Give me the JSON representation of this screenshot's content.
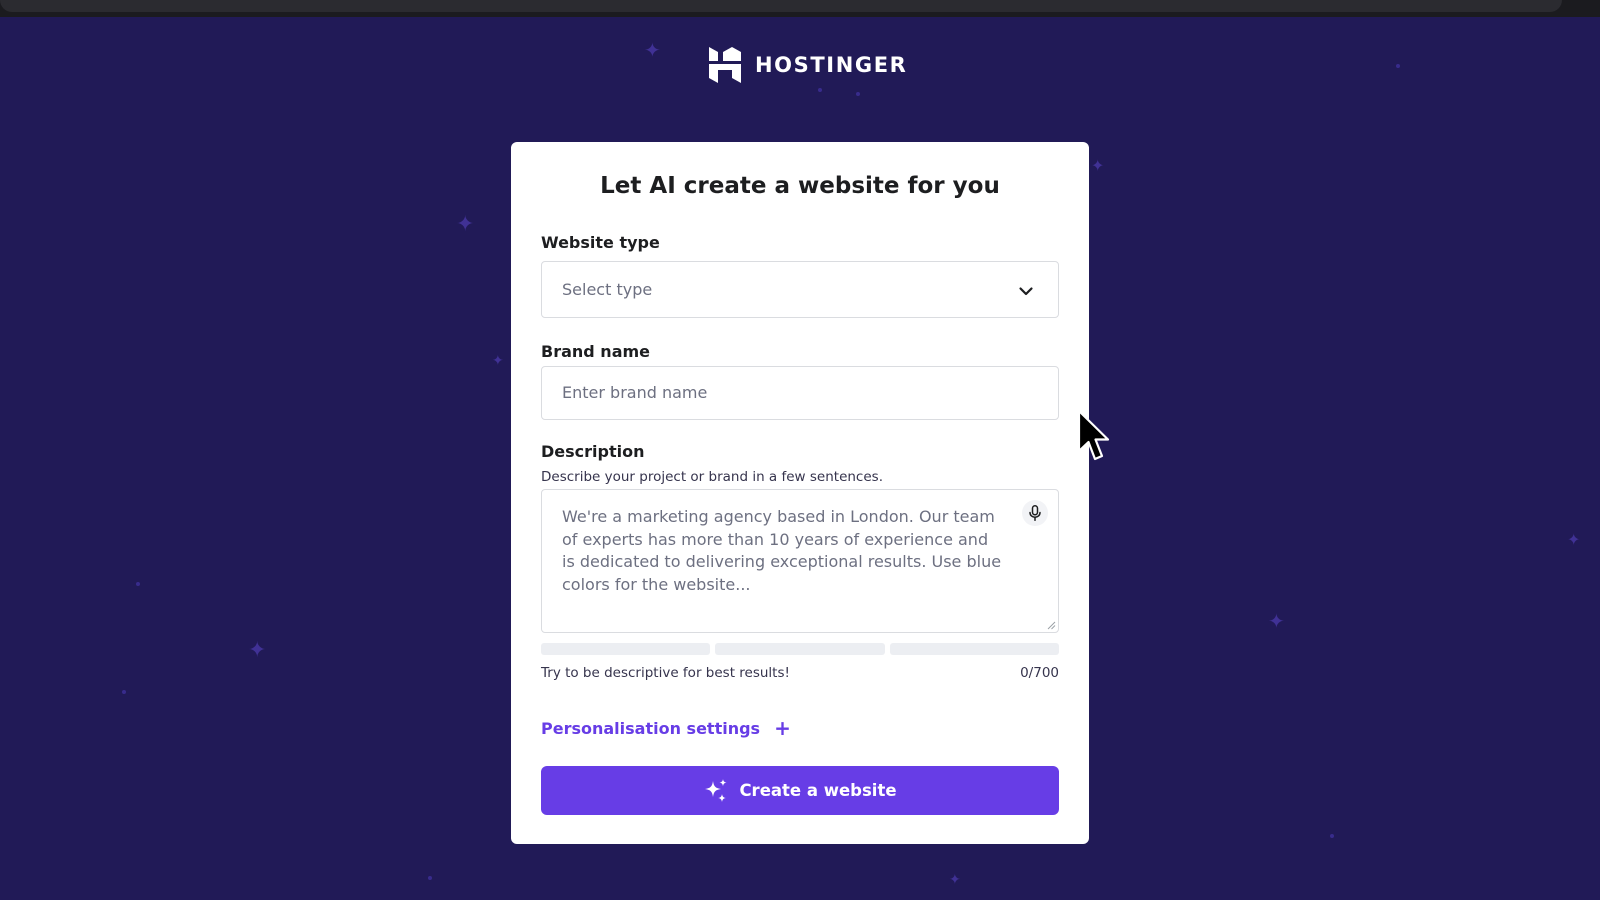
{
  "brand": {
    "name": "HOSTINGER",
    "logo_icon": "hostinger-h-logo"
  },
  "card": {
    "title": "Let AI create a website for you",
    "website_type": {
      "label": "Website type",
      "placeholder": "Select type",
      "icon": "chevron-down-icon"
    },
    "brand_name": {
      "label": "Brand name",
      "placeholder": "Enter brand name"
    },
    "description": {
      "label": "Description",
      "hint": "Describe your project or brand in a few sentences.",
      "placeholder": "We're a marketing agency based in London. Our team of experts has more than 10 years of experience and is dedicated to delivering exceptional results. Use blue colors for the website...",
      "mic_icon": "microphone-icon",
      "footer_hint": "Try to be descriptive for best results!",
      "counter": "0/700"
    },
    "personalisation": {
      "label": "Personalisation settings",
      "icon": "plus-icon"
    },
    "cta": {
      "label": "Create a website",
      "icon": "sparkles-icon"
    }
  },
  "colors": {
    "background": "#211a57",
    "accent": "#673de6",
    "card": "#ffffff"
  }
}
